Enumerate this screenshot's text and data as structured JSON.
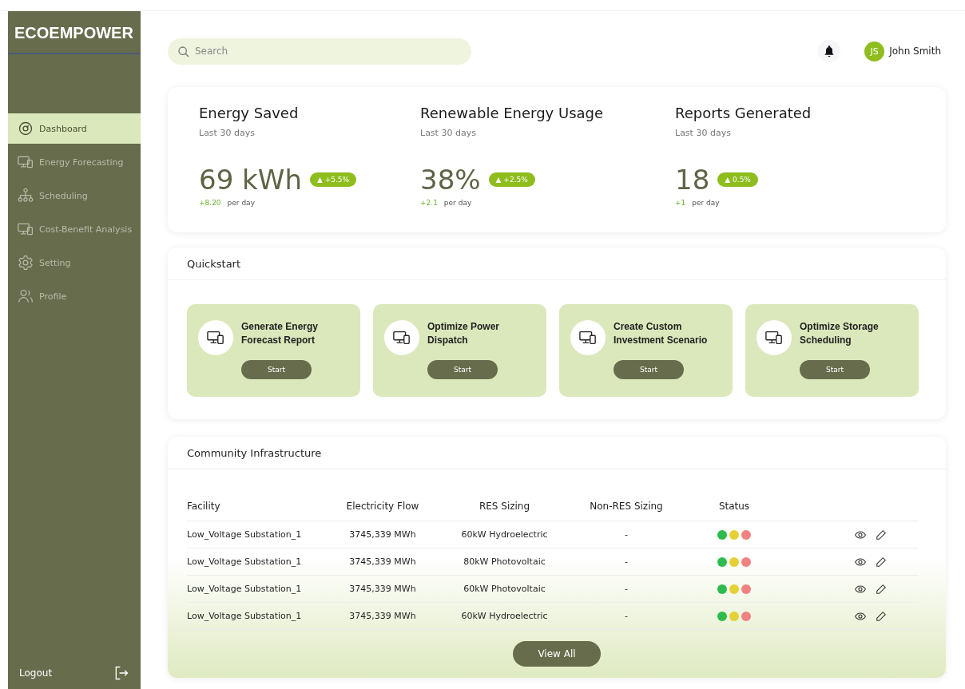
{
  "sidebar": {
    "logo": "ECOEMPOWER",
    "items": [
      {
        "label": "Dashboard",
        "selected": true
      },
      {
        "label": "Energy Forecasting",
        "selected": false
      },
      {
        "label": "Scheduling",
        "selected": false
      },
      {
        "label": "Cost-Benefit Analysis",
        "selected": false
      },
      {
        "label": "Setting",
        "selected": false
      },
      {
        "label": "Profile",
        "selected": false
      }
    ],
    "logout": "Logout"
  },
  "header": {
    "search": {
      "placeholder": "Search"
    },
    "user": {
      "initials": "JS",
      "name": "John Smith"
    }
  },
  "stats": [
    {
      "title": "Energy Saved",
      "period": "Last 30 days",
      "value": "69 kWh",
      "badge": "▲ +5.5%",
      "delta": "+8.20",
      "unit": "per day"
    },
    {
      "title": "Renewable Energy Usage",
      "period": "Last 30 days",
      "value": "38%",
      "badge": "▲ +2.5%",
      "delta": "+2.1",
      "unit": "per day"
    },
    {
      "title": "Reports Generated",
      "period": "Last 30 days",
      "value": "18",
      "badge": "▲ 0.5%",
      "delta": "+1",
      "unit": "per day"
    }
  ],
  "quickstart": {
    "title": "Quickstart",
    "cards": [
      {
        "title": "Generate Energy Forecast Report",
        "button": "Start"
      },
      {
        "title": "Optimize Power Dispatch",
        "button": "Start"
      },
      {
        "title": "Create Custom Investment Scenario",
        "button": "Start"
      },
      {
        "title": "Optimize Storage Scheduling",
        "button": "Start"
      }
    ]
  },
  "infrastructure": {
    "title": "Community Infrastructure",
    "columns": [
      "Facility",
      "Electricity Flow",
      "RES Sizing",
      "Non-RES Sizing",
      "Status"
    ],
    "rows": [
      {
        "facility": "Low_Voltage Substation_1",
        "flow": "3745,339 MWh",
        "res": "60kW Hydroelectric",
        "non_res": "-",
        "status": [
          {
            "color": "#2dbb4e"
          },
          {
            "color": "#e3d136"
          },
          {
            "color": "#f08282"
          }
        ]
      },
      {
        "facility": "Low_Voltage Substation_1",
        "flow": "3745,339 MWh",
        "res": "80kW Photovoltaic",
        "non_res": "-",
        "status": [
          {
            "color": "#2dbb4e"
          },
          {
            "color": "#e3d136"
          },
          {
            "color": "#f08282"
          }
        ]
      },
      {
        "facility": "Low_Voltage Substation_1",
        "flow": "3745,339 MWh",
        "res": "60kW Photovoltaic",
        "non_res": "-",
        "status": [
          {
            "color": "#2dbb4e"
          },
          {
            "color": "#e3d136"
          },
          {
            "color": "#f08282"
          }
        ]
      },
      {
        "facility": "Low_Voltage Substation_1",
        "flow": "3745,339 MWh",
        "res": "60kW Hydroelectric",
        "non_res": "-",
        "status": [
          {
            "color": "#2dbb4e"
          },
          {
            "color": "#e3d136"
          },
          {
            "color": "#f08282"
          }
        ]
      }
    ],
    "button": "View All"
  }
}
